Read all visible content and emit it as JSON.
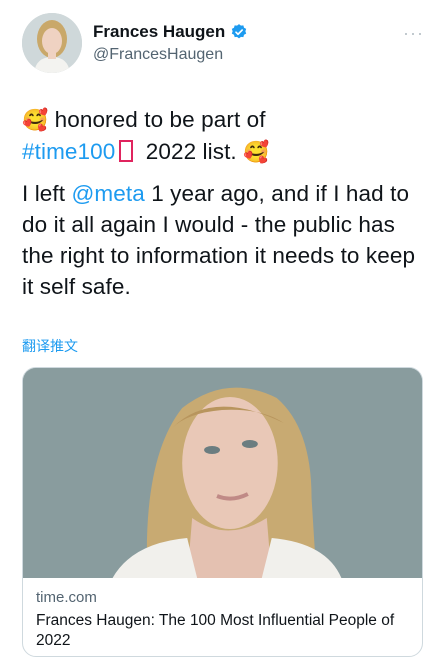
{
  "author": {
    "display_name": "Frances Haugen",
    "handle": "@FrancesHaugen",
    "verified_icon": "verified-badge-icon",
    "avatar_icon": "profile-photo"
  },
  "more_menu": {
    "label": "···"
  },
  "tweet": {
    "line1_emoji": "🥰",
    "line1_text": " honored to be part of",
    "hashtag": "#time100",
    "missing_glyph_icon": "missing-glyph-box",
    "line2_text": " 2022 list. ",
    "line2_emoji": "🥰",
    "para2_a": "I left ",
    "mention": "@meta",
    "para2_b": " 1 year ago, and if I had to do it all again I would - the public has the right to information it needs to keep it self safe."
  },
  "translate_label": "翻译推文",
  "card": {
    "image_icon": "article-portrait-photo",
    "domain": "time.com",
    "title": "Frances Haugen: The 100 Most Influential People of 2022"
  },
  "colors": {
    "link": "#1d9bf0",
    "text": "#0f1419",
    "secondary": "#536471",
    "border": "#cfd9de"
  }
}
